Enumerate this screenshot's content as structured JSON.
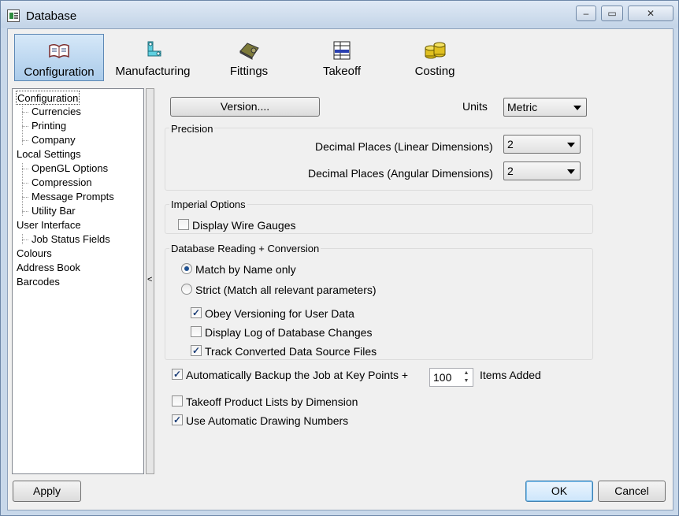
{
  "window": {
    "title": "Database"
  },
  "toolbar": {
    "items": [
      {
        "label": "Configuration",
        "icon": "book-icon",
        "active": true
      },
      {
        "label": "Manufacturing",
        "icon": "manufacturing-icon",
        "active": false
      },
      {
        "label": "Fittings",
        "icon": "fittings-icon",
        "active": false
      },
      {
        "label": "Takeoff",
        "icon": "takeoff-icon",
        "active": false
      },
      {
        "label": "Costing",
        "icon": "coins-icon",
        "active": false
      }
    ]
  },
  "tree": {
    "items": [
      {
        "label": "Configuration",
        "level": 0,
        "selected": true
      },
      {
        "label": "Currencies",
        "level": 1
      },
      {
        "label": "Printing",
        "level": 1
      },
      {
        "label": "Company",
        "level": 1
      },
      {
        "label": "Local Settings",
        "level": 0
      },
      {
        "label": "OpenGL Options",
        "level": 1
      },
      {
        "label": "Compression",
        "level": 1
      },
      {
        "label": "Message Prompts",
        "level": 1
      },
      {
        "label": "Utility Bar",
        "level": 1
      },
      {
        "label": "User Interface",
        "level": 0
      },
      {
        "label": "Job Status Fields",
        "level": 1
      },
      {
        "label": "Colours",
        "level": 0
      },
      {
        "label": "Address Book",
        "level": 0
      },
      {
        "label": "Barcodes",
        "level": 0
      }
    ],
    "collapse_glyph": "<"
  },
  "main": {
    "version_button": "Version....",
    "units_label": "Units",
    "units_value": "Metric",
    "precision": {
      "title": "Precision",
      "linear_label": "Decimal Places (Linear Dimensions)",
      "linear_value": "2",
      "angular_label": "Decimal Places (Angular Dimensions)",
      "angular_value": "2"
    },
    "imperial": {
      "title": "Imperial Options",
      "wire_gauges_label": "Display Wire Gauges",
      "wire_gauges_checked": false
    },
    "db_reading": {
      "title": "Database Reading + Conversion",
      "match_name_label": "Match by Name only",
      "match_name_selected": true,
      "strict_label": "Strict (Match all relevant parameters)",
      "strict_selected": false,
      "obey_versioning_label": "Obey Versioning for User Data",
      "obey_versioning_checked": true,
      "display_log_label": "Display Log of Database Changes",
      "display_log_checked": false,
      "track_converted_label": "Track Converted Data Source Files",
      "track_converted_checked": true
    },
    "auto_backup_label": "Automatically Backup the Job at Key Points +",
    "auto_backup_checked": true,
    "auto_backup_value": "100",
    "items_added_label": "Items Added",
    "takeoff_lists_label": "Takeoff Product Lists by Dimension",
    "takeoff_lists_checked": false,
    "auto_drawing_label": "Use Automatic Drawing Numbers",
    "auto_drawing_checked": true
  },
  "footer": {
    "apply": "Apply",
    "ok": "OK",
    "cancel": "Cancel"
  },
  "check_glyph": "✓"
}
